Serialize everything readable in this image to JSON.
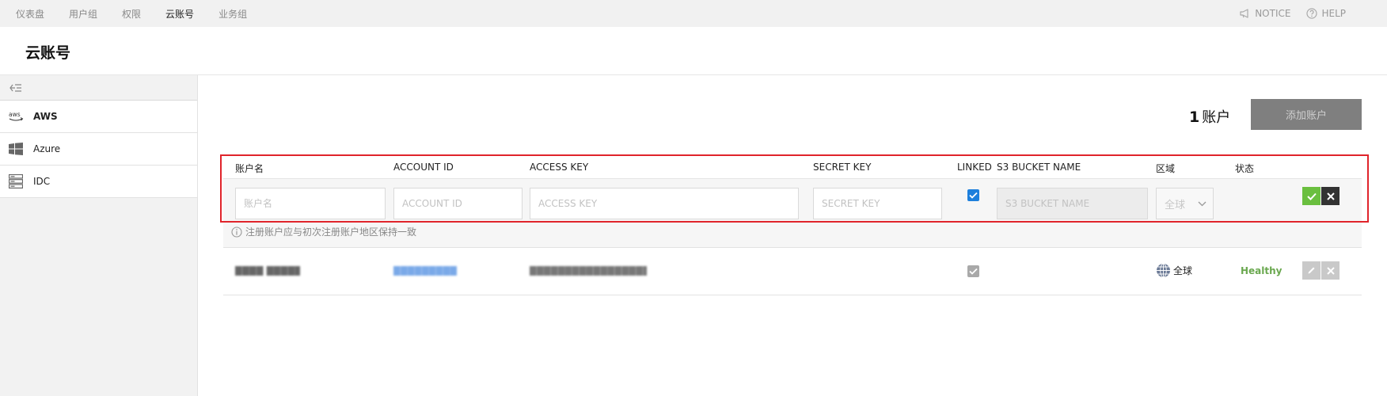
{
  "nav": {
    "items": [
      "仪表盘",
      "用户组",
      "权限",
      "云账号",
      "业务组"
    ],
    "notice": "NOTICE",
    "help": "HELP"
  },
  "page": {
    "title": "云账号"
  },
  "sidebar": {
    "items": [
      {
        "label": "AWS",
        "icon": "aws-icon"
      },
      {
        "label": "Azure",
        "icon": "windows-icon"
      },
      {
        "label": "IDC",
        "icon": "server-icon"
      }
    ]
  },
  "summary": {
    "count": "1",
    "unit": "账户",
    "add_label": "添加账户"
  },
  "table": {
    "headers": [
      "账户名",
      "ACCOUNT ID",
      "ACCESS KEY",
      "SECRET KEY",
      "LINKED",
      "S3 BUCKET NAME",
      "区域",
      "状态"
    ]
  },
  "form": {
    "account_name_placeholder": "账户名",
    "account_id_placeholder": "ACCOUNT ID",
    "access_key_placeholder": "ACCESS KEY",
    "secret_key_placeholder": "SECRET KEY",
    "linked_checked": true,
    "s3_placeholder": "S3 BUCKET NAME",
    "region_value": "全球",
    "hint": "注册账户应与初次注册账户地区保持一致"
  },
  "rows": [
    {
      "account_name": "████ ██████",
      "account_id": "████████████",
      "access_key": "████████████████████████",
      "linked": true,
      "region": "全球",
      "status": "Healthy"
    }
  ],
  "colors": {
    "accent": "#1d7fdc",
    "confirm": "#6abf3f",
    "cancel": "#333333",
    "status_ok": "#6aa84f",
    "highlight": "#e0242b"
  }
}
